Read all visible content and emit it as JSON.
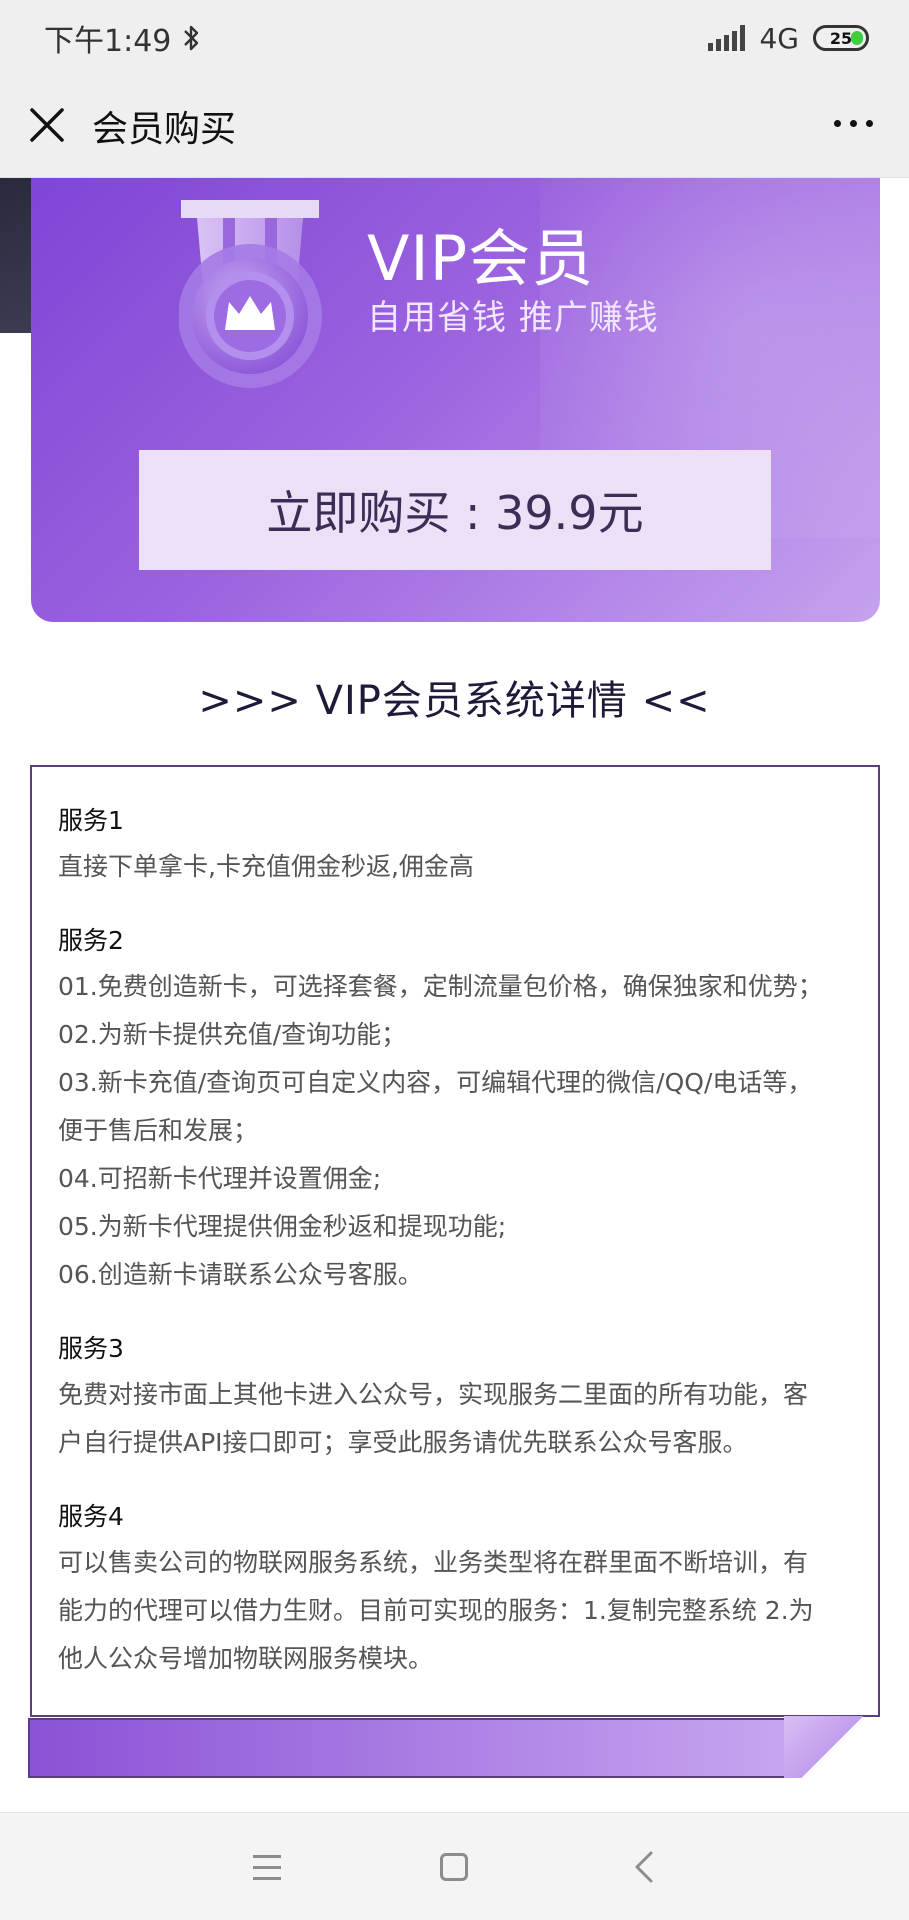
{
  "status_bar": {
    "time": "下午1:49",
    "network": "4G",
    "battery": "25",
    "icons": [
      "bluetooth-icon",
      "signal-icon",
      "battery-icon"
    ]
  },
  "nav": {
    "title": "会员购买",
    "close_icon": "close-icon",
    "more_icon": "more-icon"
  },
  "hero": {
    "title": "VIP会员",
    "subtitle": "自用省钱 推广赚钱",
    "buy_label": "立即购买 : 39.9元",
    "medal_icon": "crown-medal-icon",
    "colors": {
      "gradient_start": "#7f45d6",
      "gradient_end": "#c6a2ef",
      "button_bg": "#ece0f7"
    }
  },
  "details": {
    "heading": ">>>  VIP会员系统详情  <<",
    "services": [
      {
        "title": "服务1",
        "lines": [
          "直接下单拿卡,卡充值佣金秒返,佣金高"
        ]
      },
      {
        "title": "服务2",
        "lines": [
          "01.免费创造新卡，可选择套餐，定制流量包价格，确保独家和优势；",
          "02.为新卡提供充值/查询功能；",
          "03.新卡充值/查询页可自定义内容，可编辑代理的微信/QQ/电话等，",
          "便于售后和发展；",
          "04.可招新卡代理并设置佣金;",
          "05.为新卡代理提供佣金秒返和提现功能;",
          "06.创造新卡请联系公众号客服。"
        ]
      },
      {
        "title": "服务3",
        "lines": [
          "免费对接市面上其他卡进入公众号，实现服务二里面的所有功能，客",
          "户自行提供API接口即可；享受此服务请优先联系公众号客服。"
        ]
      },
      {
        "title": "服务4",
        "lines": [
          "可以售卖公司的物联网服务系统，业务类型将在群里面不断培训，有",
          "能力的代理可以借力生财。目前可实现的服务：1.复制完整系统 2.为",
          "他人公众号增加物联网服务模块。"
        ]
      }
    ]
  },
  "system_nav": {
    "icons": [
      "menu-icon",
      "home-icon",
      "back-icon"
    ]
  }
}
